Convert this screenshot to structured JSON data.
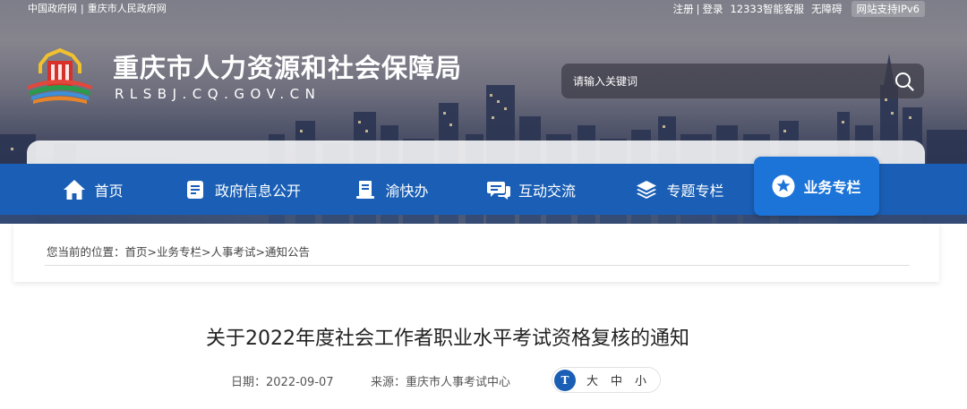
{
  "topbar": {
    "left_links": [
      "中国政府网",
      "重庆市人民政府网"
    ],
    "register": "注册",
    "login": "登录",
    "service": "12333智能客服",
    "accessibility": "无障碍",
    "ipv6": "网站支持IPv6"
  },
  "site": {
    "name": "重庆市人力资源和社会保障局",
    "domain": "RLSBJ.CQ.GOV.CN"
  },
  "search": {
    "placeholder": "请输入关键词",
    "icon": "search-icon"
  },
  "nav": {
    "items": [
      {
        "label": "首页",
        "icon": "home-icon"
      },
      {
        "label": "政府信息公开",
        "icon": "document-icon"
      },
      {
        "label": "渝快办",
        "icon": "handbook-icon"
      },
      {
        "label": "互动交流",
        "icon": "chat-icon"
      },
      {
        "label": "专题专栏",
        "icon": "layers-icon"
      },
      {
        "label": "业务专栏",
        "icon": "star-icon",
        "active": true
      }
    ],
    "colors": {
      "bar": "#1a5fb5",
      "active": "#1d74d8"
    }
  },
  "breadcrumb": {
    "prefix": "您当前的位置：",
    "items": [
      "首页",
      "业务专栏",
      "人事考试",
      "通知公告"
    ],
    "separator": ">"
  },
  "article": {
    "title": "关于2022年度社会工作者职业水平考试资格复核的通知",
    "date_label": "日期：2022-09-07",
    "source_label": "来源：重庆市人事考试中心",
    "font_size": {
      "icon": "text-size-icon",
      "options": [
        "大",
        "中",
        "小"
      ]
    }
  }
}
